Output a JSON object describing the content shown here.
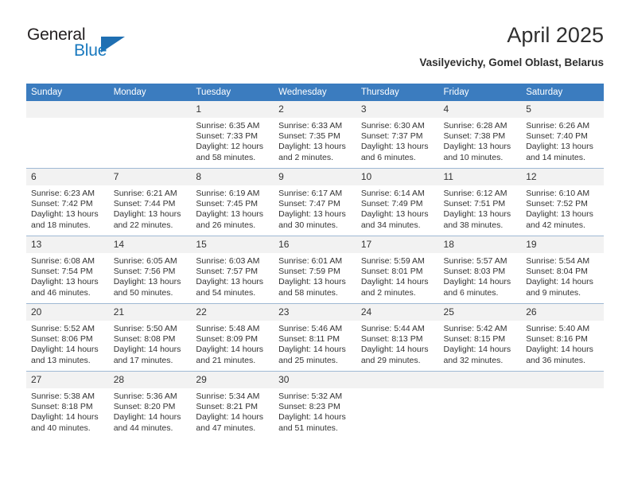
{
  "logo": {
    "word_top": "General",
    "word_bottom": "Blue",
    "triangle": "blue-triangle-icon"
  },
  "header": {
    "title": "April 2025",
    "subtitle": "Vasilyevichy, Gomel Oblast, Belarus"
  },
  "colors": {
    "header_blue": "#3b7cbf",
    "logo_blue": "#1878be",
    "daynum_band": "#f2f2f2",
    "grid_line": "#9fb9d4",
    "text": "#333333"
  },
  "weekday_headers": [
    "Sunday",
    "Monday",
    "Tuesday",
    "Wednesday",
    "Thursday",
    "Friday",
    "Saturday"
  ],
  "labels": {
    "sunrise_prefix": "Sunrise:",
    "sunset_prefix": "Sunset:",
    "daylight_prefix": "Daylight:"
  },
  "weeks": [
    [
      {
        "day": "",
        "blank": true
      },
      {
        "day": "",
        "blank": true
      },
      {
        "day": "1",
        "sunrise": "Sunrise: 6:35 AM",
        "sunset": "Sunset: 7:33 PM",
        "daylight_1": "Daylight: 12 hours",
        "daylight_2": "and 58 minutes."
      },
      {
        "day": "2",
        "sunrise": "Sunrise: 6:33 AM",
        "sunset": "Sunset: 7:35 PM",
        "daylight_1": "Daylight: 13 hours",
        "daylight_2": "and 2 minutes."
      },
      {
        "day": "3",
        "sunrise": "Sunrise: 6:30 AM",
        "sunset": "Sunset: 7:37 PM",
        "daylight_1": "Daylight: 13 hours",
        "daylight_2": "and 6 minutes."
      },
      {
        "day": "4",
        "sunrise": "Sunrise: 6:28 AM",
        "sunset": "Sunset: 7:38 PM",
        "daylight_1": "Daylight: 13 hours",
        "daylight_2": "and 10 minutes."
      },
      {
        "day": "5",
        "sunrise": "Sunrise: 6:26 AM",
        "sunset": "Sunset: 7:40 PM",
        "daylight_1": "Daylight: 13 hours",
        "daylight_2": "and 14 minutes."
      }
    ],
    [
      {
        "day": "6",
        "sunrise": "Sunrise: 6:23 AM",
        "sunset": "Sunset: 7:42 PM",
        "daylight_1": "Daylight: 13 hours",
        "daylight_2": "and 18 minutes."
      },
      {
        "day": "7",
        "sunrise": "Sunrise: 6:21 AM",
        "sunset": "Sunset: 7:44 PM",
        "daylight_1": "Daylight: 13 hours",
        "daylight_2": "and 22 minutes."
      },
      {
        "day": "8",
        "sunrise": "Sunrise: 6:19 AM",
        "sunset": "Sunset: 7:45 PM",
        "daylight_1": "Daylight: 13 hours",
        "daylight_2": "and 26 minutes."
      },
      {
        "day": "9",
        "sunrise": "Sunrise: 6:17 AM",
        "sunset": "Sunset: 7:47 PM",
        "daylight_1": "Daylight: 13 hours",
        "daylight_2": "and 30 minutes."
      },
      {
        "day": "10",
        "sunrise": "Sunrise: 6:14 AM",
        "sunset": "Sunset: 7:49 PM",
        "daylight_1": "Daylight: 13 hours",
        "daylight_2": "and 34 minutes."
      },
      {
        "day": "11",
        "sunrise": "Sunrise: 6:12 AM",
        "sunset": "Sunset: 7:51 PM",
        "daylight_1": "Daylight: 13 hours",
        "daylight_2": "and 38 minutes."
      },
      {
        "day": "12",
        "sunrise": "Sunrise: 6:10 AM",
        "sunset": "Sunset: 7:52 PM",
        "daylight_1": "Daylight: 13 hours",
        "daylight_2": "and 42 minutes."
      }
    ],
    [
      {
        "day": "13",
        "sunrise": "Sunrise: 6:08 AM",
        "sunset": "Sunset: 7:54 PM",
        "daylight_1": "Daylight: 13 hours",
        "daylight_2": "and 46 minutes."
      },
      {
        "day": "14",
        "sunrise": "Sunrise: 6:05 AM",
        "sunset": "Sunset: 7:56 PM",
        "daylight_1": "Daylight: 13 hours",
        "daylight_2": "and 50 minutes."
      },
      {
        "day": "15",
        "sunrise": "Sunrise: 6:03 AM",
        "sunset": "Sunset: 7:57 PM",
        "daylight_1": "Daylight: 13 hours",
        "daylight_2": "and 54 minutes."
      },
      {
        "day": "16",
        "sunrise": "Sunrise: 6:01 AM",
        "sunset": "Sunset: 7:59 PM",
        "daylight_1": "Daylight: 13 hours",
        "daylight_2": "and 58 minutes."
      },
      {
        "day": "17",
        "sunrise": "Sunrise: 5:59 AM",
        "sunset": "Sunset: 8:01 PM",
        "daylight_1": "Daylight: 14 hours",
        "daylight_2": "and 2 minutes."
      },
      {
        "day": "18",
        "sunrise": "Sunrise: 5:57 AM",
        "sunset": "Sunset: 8:03 PM",
        "daylight_1": "Daylight: 14 hours",
        "daylight_2": "and 6 minutes."
      },
      {
        "day": "19",
        "sunrise": "Sunrise: 5:54 AM",
        "sunset": "Sunset: 8:04 PM",
        "daylight_1": "Daylight: 14 hours",
        "daylight_2": "and 9 minutes."
      }
    ],
    [
      {
        "day": "20",
        "sunrise": "Sunrise: 5:52 AM",
        "sunset": "Sunset: 8:06 PM",
        "daylight_1": "Daylight: 14 hours",
        "daylight_2": "and 13 minutes."
      },
      {
        "day": "21",
        "sunrise": "Sunrise: 5:50 AM",
        "sunset": "Sunset: 8:08 PM",
        "daylight_1": "Daylight: 14 hours",
        "daylight_2": "and 17 minutes."
      },
      {
        "day": "22",
        "sunrise": "Sunrise: 5:48 AM",
        "sunset": "Sunset: 8:09 PM",
        "daylight_1": "Daylight: 14 hours",
        "daylight_2": "and 21 minutes."
      },
      {
        "day": "23",
        "sunrise": "Sunrise: 5:46 AM",
        "sunset": "Sunset: 8:11 PM",
        "daylight_1": "Daylight: 14 hours",
        "daylight_2": "and 25 minutes."
      },
      {
        "day": "24",
        "sunrise": "Sunrise: 5:44 AM",
        "sunset": "Sunset: 8:13 PM",
        "daylight_1": "Daylight: 14 hours",
        "daylight_2": "and 29 minutes."
      },
      {
        "day": "25",
        "sunrise": "Sunrise: 5:42 AM",
        "sunset": "Sunset: 8:15 PM",
        "daylight_1": "Daylight: 14 hours",
        "daylight_2": "and 32 minutes."
      },
      {
        "day": "26",
        "sunrise": "Sunrise: 5:40 AM",
        "sunset": "Sunset: 8:16 PM",
        "daylight_1": "Daylight: 14 hours",
        "daylight_2": "and 36 minutes."
      }
    ],
    [
      {
        "day": "27",
        "sunrise": "Sunrise: 5:38 AM",
        "sunset": "Sunset: 8:18 PM",
        "daylight_1": "Daylight: 14 hours",
        "daylight_2": "and 40 minutes."
      },
      {
        "day": "28",
        "sunrise": "Sunrise: 5:36 AM",
        "sunset": "Sunset: 8:20 PM",
        "daylight_1": "Daylight: 14 hours",
        "daylight_2": "and 44 minutes."
      },
      {
        "day": "29",
        "sunrise": "Sunrise: 5:34 AM",
        "sunset": "Sunset: 8:21 PM",
        "daylight_1": "Daylight: 14 hours",
        "daylight_2": "and 47 minutes."
      },
      {
        "day": "30",
        "sunrise": "Sunrise: 5:32 AM",
        "sunset": "Sunset: 8:23 PM",
        "daylight_1": "Daylight: 14 hours",
        "daylight_2": "and 51 minutes."
      },
      {
        "day": "",
        "blank": true
      },
      {
        "day": "",
        "blank": true
      },
      {
        "day": "",
        "blank": true
      }
    ]
  ]
}
